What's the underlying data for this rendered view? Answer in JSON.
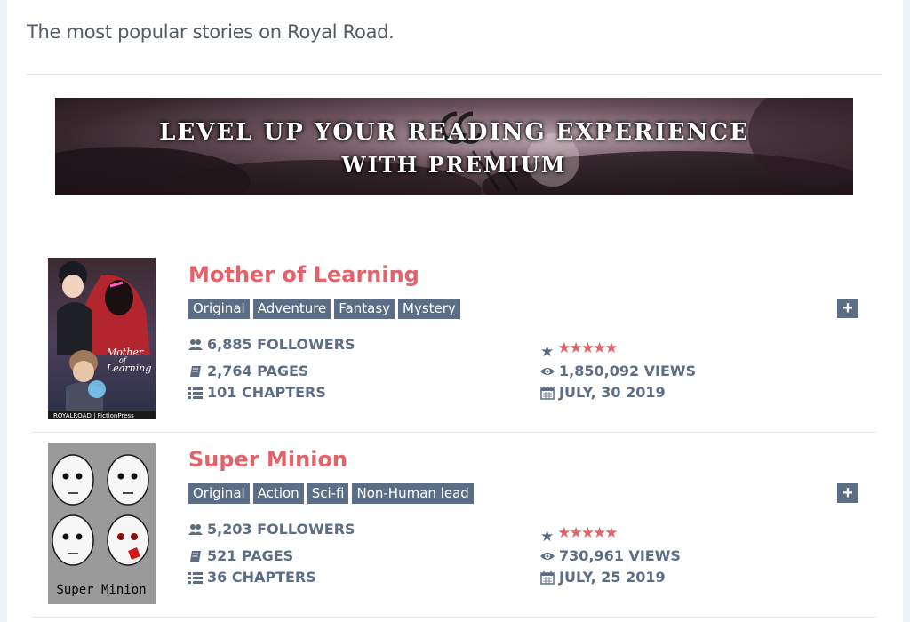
{
  "intro": "The most popular stories on Royal Road.",
  "banner": {
    "line1": "LEVEL UP YOUR READING EXPERIENCE",
    "line2": "WITH PREMIUM"
  },
  "fictions": [
    {
      "title": "Mother of Learning",
      "tags": [
        "Original",
        "Adventure",
        "Fantasy",
        "Mystery"
      ],
      "followers": "6,885 FOLLOWERS",
      "pages": "2,764 PAGES",
      "chapters": "101 CHAPTERS",
      "views": "1,850,092 VIEWS",
      "date": "JULY, 30 2019",
      "rating": 5,
      "cover_text": [
        "Mother",
        "of",
        "Learning",
        "ROYALROAD | FictionPress"
      ]
    },
    {
      "title": "Super Minion",
      "tags": [
        "Original",
        "Action",
        "Sci-fi",
        "Non-Human lead"
      ],
      "followers": "5,203 FOLLOWERS",
      "pages": "521 PAGES",
      "chapters": "36 CHAPTERS",
      "views": "730,961 VIEWS",
      "date": "JULY, 25 2019",
      "rating": 5,
      "cover_text": [
        "Super Minion"
      ]
    }
  ],
  "colors": {
    "title": "#e3636b",
    "tag_bg": "#5c6e85",
    "stat": "#5c6e85",
    "star": "#e3636b"
  },
  "icons": {
    "followers": "users-icon",
    "pages": "book-icon",
    "chapters": "list-icon",
    "views": "eye-icon",
    "date": "calendar-icon",
    "rating": "star-icon",
    "add": "plus-icon"
  }
}
